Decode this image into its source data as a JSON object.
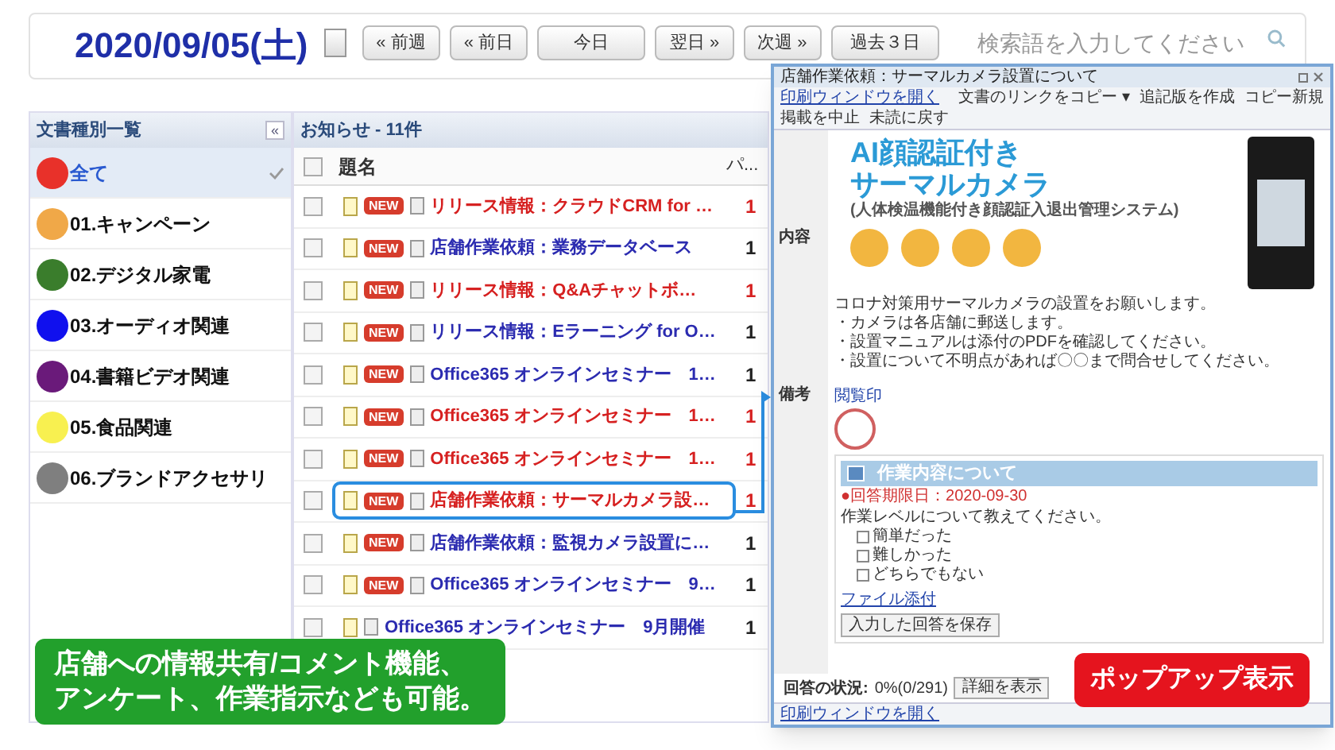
{
  "date": "2020/09/05(土)",
  "nav_buttons": [
    "« 前週",
    "« 前日",
    "今日",
    "翌日 »",
    "次週 »",
    "過去３日"
  ],
  "search": {
    "placeholder": "検索語を入力してください"
  },
  "categories": {
    "title": "文書種別一覧",
    "collapse": "«",
    "items": [
      {
        "label": "全て",
        "color": "#e8312a",
        "selected": true
      },
      {
        "label": "01.キャンペーン",
        "color": "#f0a848",
        "selected": false
      },
      {
        "label": "02.デジタル家電",
        "color": "#3a7d2c",
        "selected": false
      },
      {
        "label": "03.オーディオ関連",
        "color": "#1010ee",
        "selected": false
      },
      {
        "label": "04.書籍ビデオ関連",
        "color": "#6a1a7a",
        "selected": false
      },
      {
        "label": "05.食品関連",
        "color": "#f8f050",
        "selected": false
      },
      {
        "label": "06.ブランドアクセサリ",
        "color": "#7f7f7f",
        "selected": false
      }
    ]
  },
  "notices": {
    "title": "お知らせ - 11件",
    "select_all_checked": false,
    "columns": [
      "題名",
      "パ..."
    ],
    "rows": [
      {
        "title": "リリース情報：クラウドCRM for …",
        "count": "1",
        "badge": "NEW",
        "checked": false,
        "important": true,
        "highlighted": false
      },
      {
        "title": "店舗作業依頼：業務データベース",
        "count": "1",
        "badge": "NEW",
        "checked": false,
        "important": false,
        "highlighted": false
      },
      {
        "title": "リリース情報：Q&Aチャットボ…",
        "count": "1",
        "badge": "NEW",
        "checked": false,
        "important": true,
        "highlighted": false
      },
      {
        "title": "リリース情報：Eラーニング for O…",
        "count": "1",
        "badge": "NEW",
        "checked": false,
        "important": false,
        "highlighted": false
      },
      {
        "title": "Office365 オンラインセミナー　1…",
        "count": "1",
        "badge": "NEW",
        "checked": false,
        "important": false,
        "highlighted": false
      },
      {
        "title": "Office365 オンラインセミナー　1…",
        "count": "1",
        "badge": "NEW",
        "checked": false,
        "important": true,
        "highlighted": false
      },
      {
        "title": "Office365 オンラインセミナー　1…",
        "count": "1",
        "badge": "NEW",
        "checked": false,
        "important": true,
        "highlighted": false
      },
      {
        "title": "店舗作業依頼：サーマルカメラ設…",
        "count": "1",
        "badge": "NEW",
        "checked": false,
        "important": true,
        "highlighted": true
      },
      {
        "title": "店舗作業依頼：監視カメラ設置に…",
        "count": "1",
        "badge": "NEW",
        "checked": false,
        "important": false,
        "highlighted": false
      },
      {
        "title": "Office365 オンラインセミナー　9…",
        "count": "1",
        "badge": "NEW",
        "checked": false,
        "important": false,
        "highlighted": false
      },
      {
        "title": "Office365 オンラインセミナー　9月開催",
        "count": "1",
        "checked": false,
        "important": false,
        "highlighted": false
      }
    ]
  },
  "popup": {
    "title": "店舗作業依頼：サーマルカメラ設置について",
    "print_link": "印刷ウィンドウを開く",
    "toolbar": [
      "文書のリンクをコピー ▾",
      "追記版を作成",
      "コピー新規",
      "掲載を中止",
      "未読に戻す"
    ],
    "content_label": "内容",
    "banner": {
      "heading": [
        "AI顔認証付き",
        "サーマルカメラ"
      ],
      "subheading": "(人体検温機能付き顔認証入退出管理システム)"
    },
    "body": [
      "コロナ対策用サーマルカメラの設置をお願いします。",
      "・カメラは各店舗に郵送します。",
      "・設置マニュアルは添付のPDFを確認してください。",
      "・設置について不明点があれば〇〇まで問合せしてください。"
    ],
    "remarks_label": "備考",
    "stamp_label": "閲覧印",
    "survey": {
      "title": "作業内容について",
      "deadline": "●回答期限日：2020-09-30",
      "question": "作業レベルについて教えてください。",
      "options": [
        {
          "label": "簡単だった",
          "checked": false
        },
        {
          "label": "難しかった",
          "checked": false
        },
        {
          "label": "どちらでもない",
          "checked": false
        }
      ],
      "attach_link": "ファイル添付",
      "save_button": "入力した回答を保存",
      "status_label": "回答の状況:",
      "status_value": "0%(0/291)",
      "detail_button": "詳細を表示"
    },
    "footer_link": "印刷ウィンドウを開く"
  },
  "callouts": {
    "feature": [
      "店舗への情報共有/コメント機能、",
      "アンケート、作業指示なども可能。"
    ],
    "popup": "ポップアップ表示"
  }
}
